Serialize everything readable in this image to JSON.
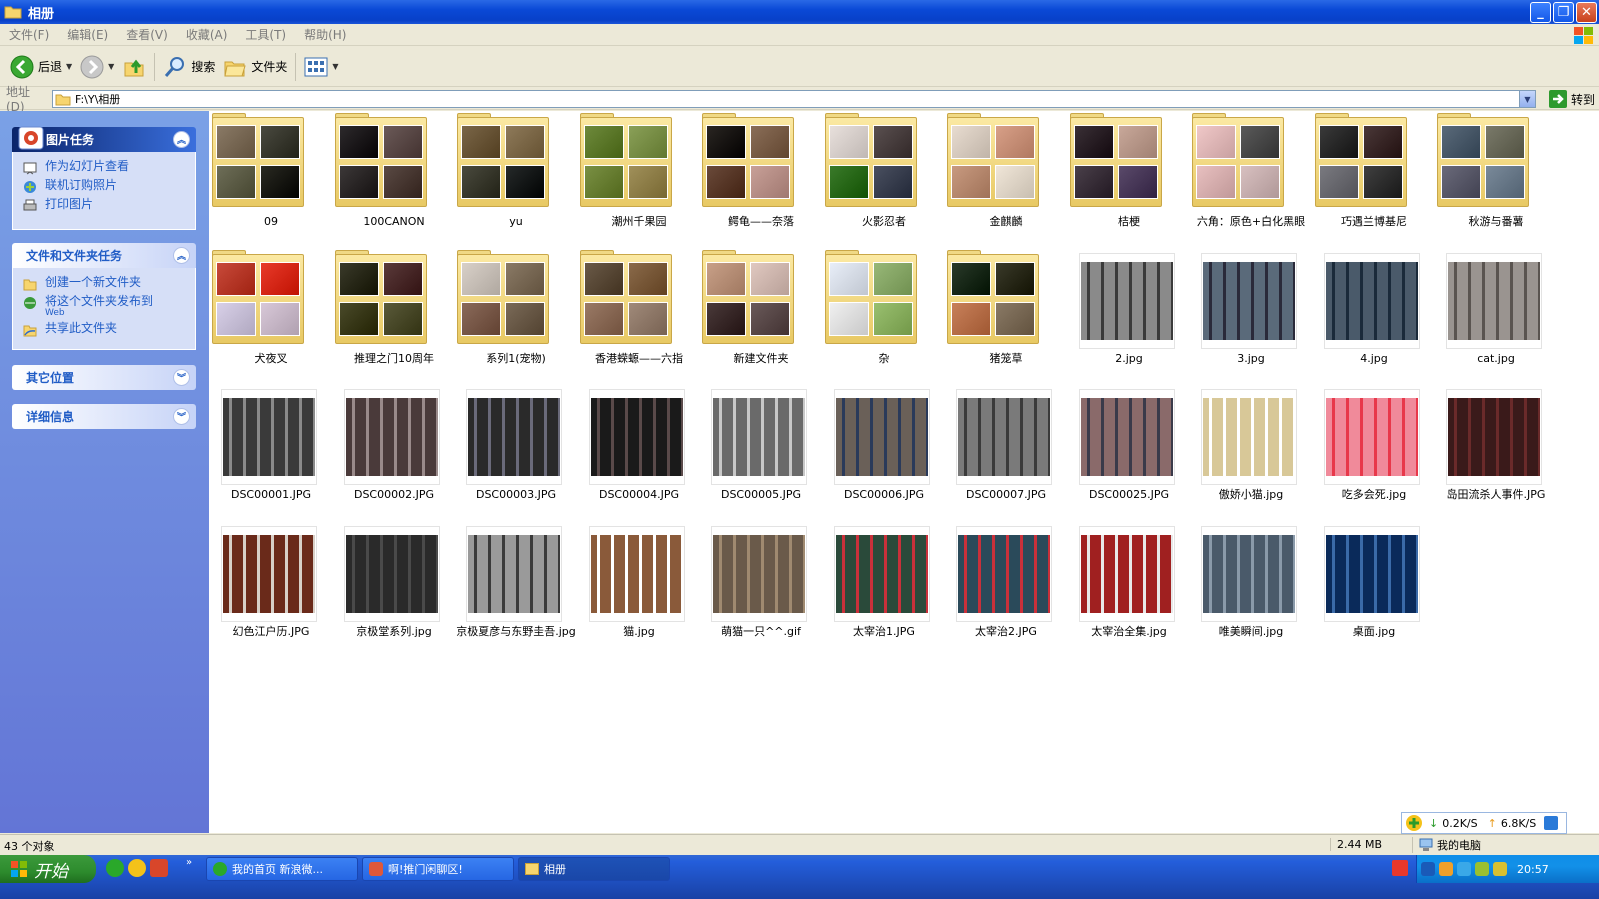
{
  "window": {
    "title": "相册",
    "controls": [
      "minimize",
      "restore",
      "close"
    ]
  },
  "menu": [
    "文件(F)",
    "编辑(E)",
    "查看(V)",
    "收藏(A)",
    "工具(T)",
    "帮助(H)"
  ],
  "toolbar": {
    "back": "后退",
    "search": "搜索",
    "folders": "文件夹"
  },
  "address": {
    "label": "地址(D)",
    "path": "F:\\Y\\相册",
    "go": "转到"
  },
  "taskpane": {
    "picture_tasks": {
      "title": "图片任务",
      "items": [
        "作为幻灯片查看",
        "联机订购照片",
        "打印图片"
      ]
    },
    "file_tasks": {
      "title": "文件和文件夹任务",
      "items": [
        {
          "label": "创建一个新文件夹",
          "sub": ""
        },
        {
          "label": "将这个文件夹发布到",
          "sub": "Web"
        },
        {
          "label": "共享此文件夹",
          "sub": ""
        }
      ]
    },
    "other_places": {
      "title": "其它位置"
    },
    "details": {
      "title": "详细信息"
    }
  },
  "items": [
    {
      "name": "09",
      "kind": "folder",
      "colors": [
        "#8a7a66",
        "#4a4a40",
        "#6e6e58",
        "#2a2a22"
      ]
    },
    {
      "name": "100CANON",
      "kind": "folder",
      "colors": [
        "#2d2a2c",
        "#6b5a58",
        "#3c3838",
        "#5a4a44"
      ]
    },
    {
      "name": "yu",
      "kind": "folder",
      "colors": [
        "#7a6648",
        "#8e7a5a",
        "#4a4a3e",
        "#262a2a"
      ]
    },
    {
      "name": "潮州千果园",
      "kind": "folder",
      "colors": [
        "#6e8a3c",
        "#8aa058",
        "#7a9044",
        "#a0905a"
      ]
    },
    {
      "name": "鳄龟——奈落",
      "kind": "folder",
      "colors": [
        "#2a2622",
        "#8a6e58",
        "#6a4a3a",
        "#c8a098"
      ]
    },
    {
      "name": "火影忍者",
      "kind": "folder",
      "colors": [
        "#e8e0dc",
        "#5a5050",
        "#3a7a2a",
        "#4a5060"
      ]
    },
    {
      "name": "金麒麟",
      "kind": "folder",
      "colors": [
        "#e8dcd0",
        "#d8a088",
        "#c89a80",
        "#f0e6d8"
      ]
    },
    {
      "name": "桔梗",
      "kind": "folder",
      "colors": [
        "#3a3036",
        "#c8a89a",
        "#4a404a",
        "#5a4a6a"
      ]
    },
    {
      "name": "六角：原色+白化黑眼",
      "kind": "folder",
      "colors": [
        "#f0c8c8",
        "#5a5a5a",
        "#e8c0c0",
        "#d8c0c0"
      ]
    },
    {
      "name": "巧遇兰博基尼",
      "kind": "folder",
      "colors": [
        "#3a3a3a",
        "#4a3838",
        "#7a7a80",
        "#404040"
      ]
    },
    {
      "name": "秋游与番薯",
      "kind": "folder",
      "colors": [
        "#5a6a7a",
        "#7a7a6a",
        "#6a6a7a",
        "#7a8a9a"
      ]
    },
    {
      "name": "犬夜叉",
      "kind": "folder",
      "colors": [
        "#c84a3a",
        "#e83a2a",
        "#d8d0e8",
        "#d8c8d8"
      ]
    },
    {
      "name": "推理之门10周年",
      "kind": "folder",
      "colors": [
        "#3a3a2a",
        "#5a3a3a",
        "#4a4a2a",
        "#5a5a3a"
      ]
    },
    {
      "name": "系列1(宠物)",
      "kind": "folder",
      "colors": [
        "#d8d0c8",
        "#8a7a66",
        "#8a6a5a",
        "#7a6a58"
      ]
    },
    {
      "name": "香港蝾螈——六指",
      "kind": "folder",
      "colors": [
        "#6a5a48",
        "#8a6a4a",
        "#9a7a66",
        "#a08a7a"
      ]
    },
    {
      "name": "新建文件夹",
      "kind": "folder",
      "colors": [
        "#c8a088",
        "#e0c8c0",
        "#4a3a3a",
        "#6a5a5a"
      ]
    },
    {
      "name": "杂",
      "kind": "folder",
      "colors": [
        "#e8eef8",
        "#98b878",
        "#f0f0f0",
        "#9ac070"
      ]
    },
    {
      "name": "猪笼草",
      "kind": "folder",
      "colors": [
        "#2a3a2a",
        "#3a3a2a",
        "#c8805a",
        "#8a7a66"
      ]
    },
    {
      "name": "2.jpg",
      "kind": "image",
      "colors": [
        "#8a8a8a",
        "#3a3a3a"
      ]
    },
    {
      "name": "3.jpg",
      "kind": "image",
      "colors": [
        "#5a6a7a",
        "#2a2a3a"
      ]
    },
    {
      "name": "4.jpg",
      "kind": "image",
      "colors": [
        "#4a5a6a",
        "#1a2a3a"
      ]
    },
    {
      "name": "cat.jpg",
      "kind": "image",
      "colors": [
        "#9a9490",
        "#5a5450"
      ]
    },
    {
      "name": "DSC00001.JPG",
      "kind": "image",
      "colors": [
        "#3a3a3a",
        "#8a8a8a"
      ]
    },
    {
      "name": "DSC00002.JPG",
      "kind": "image",
      "colors": [
        "#4a3a3a",
        "#9a8a8a"
      ]
    },
    {
      "name": "DSC00003.JPG",
      "kind": "image",
      "colors": [
        "#2a2a2a",
        "#6a6a7a"
      ]
    },
    {
      "name": "DSC00004.JPG",
      "kind": "image",
      "colors": [
        "#1a1a1a",
        "#5a4a4a"
      ]
    },
    {
      "name": "DSC00005.JPG",
      "kind": "image",
      "colors": [
        "#6a6a6a",
        "#c8c8c8"
      ]
    },
    {
      "name": "DSC00006.JPG",
      "kind": "image",
      "colors": [
        "#6a6058",
        "#2a3a5a"
      ]
    },
    {
      "name": "DSC00007.JPG",
      "kind": "image",
      "colors": [
        "#7a7a7a",
        "#3a3a3a"
      ]
    },
    {
      "name": "DSC00025.JPG",
      "kind": "image",
      "colors": [
        "#8a6a6a",
        "#3a3a4a"
      ]
    },
    {
      "name": "傲娇小猫.jpg",
      "kind": "image",
      "colors": [
        "#d8c898",
        "#ffffff"
      ]
    },
    {
      "name": "吃多会死.jpg",
      "kind": "image",
      "colors": [
        "#f08a9a",
        "#e8384a"
      ]
    },
    {
      "name": "岛田流杀人事件.JPG",
      "kind": "image",
      "colors": [
        "#3a1a1a",
        "#6a2a2a"
      ]
    },
    {
      "name": "幻色江户历.JPG",
      "kind": "image",
      "colors": [
        "#6a2a1a",
        "#d8d0c8"
      ]
    },
    {
      "name": "京极堂系列.jpg",
      "kind": "image",
      "colors": [
        "#2a2a2a",
        "#4a4a4a"
      ]
    },
    {
      "name": "京极夏彦与东野圭吾.jpg",
      "kind": "image",
      "colors": [
        "#9a9a9a",
        "#3a3a3a"
      ]
    },
    {
      "name": "猫.jpg",
      "kind": "image",
      "colors": [
        "#8a5a3a",
        "#ffffff"
      ]
    },
    {
      "name": "萌猫一只^^.gif",
      "kind": "image",
      "colors": [
        "#6a5a4a",
        "#a08a70"
      ]
    },
    {
      "name": "太宰治1.JPG",
      "kind": "image",
      "colors": [
        "#2a4a3a",
        "#c8303a"
      ]
    },
    {
      "name": "太宰治2.JPG",
      "kind": "image",
      "colors": [
        "#2a4a5a",
        "#c8303a"
      ]
    },
    {
      "name": "太宰治全集.jpg",
      "kind": "image",
      "colors": [
        "#a02020",
        "#e8e8e8"
      ]
    },
    {
      "name": "唯美瞬间.jpg",
      "kind": "image",
      "colors": [
        "#4a5a6a",
        "#8a9aaa"
      ]
    },
    {
      "name": "桌面.jpg",
      "kind": "image",
      "colors": [
        "#0a2a5a",
        "#3a6aa8"
      ]
    }
  ],
  "transfer": {
    "down": "0.2K/S",
    "up": "6.8K/S"
  },
  "statusbar": {
    "count": "43 个对象",
    "size": "2.44 MB",
    "location": "我的电脑"
  },
  "taskbar": {
    "start": "开始",
    "tasks": [
      "我的首页 新浪微...",
      "啊!推门闲聊区!",
      "相册"
    ],
    "clock": "20:57"
  }
}
